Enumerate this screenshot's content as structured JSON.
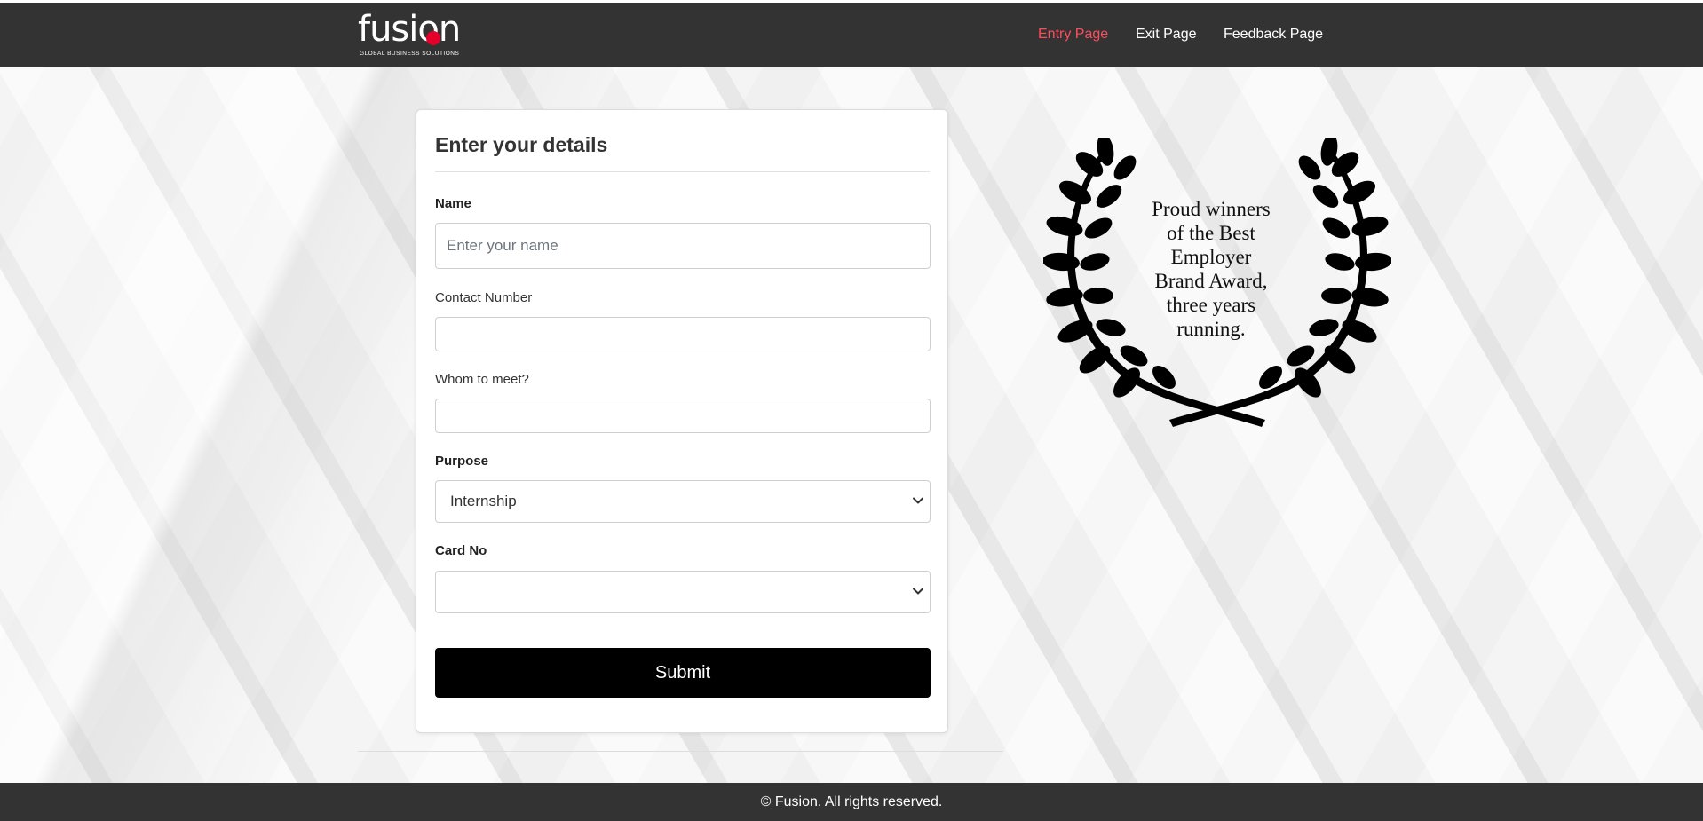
{
  "brand": {
    "name": "fusion",
    "tagline": "GLOBAL BUSINESS SOLUTIONS",
    "accent_color": "#e4002b"
  },
  "nav": {
    "items": [
      {
        "label": "Entry Page",
        "active": true
      },
      {
        "label": "Exit Page",
        "active": false
      },
      {
        "label": "Feedback Page",
        "active": false
      }
    ]
  },
  "form": {
    "title": "Enter your details",
    "name_label": "Name",
    "name_placeholder": "Enter your name",
    "name_value": "",
    "contact_label": "Contact Number",
    "contact_value": "",
    "whom_label": "Whom to meet?",
    "whom_value": "",
    "purpose_label": "Purpose",
    "purpose_selected": "Internship",
    "card_label": "Card No",
    "card_selected": "",
    "submit_label": "Submit"
  },
  "award": {
    "text": "Proud winners of the Best Employer Brand Award, three years running.",
    "lines": [
      "Proud winners",
      "of the Best",
      "Employer",
      "Brand Award,",
      "three years",
      "running."
    ]
  },
  "footer": {
    "text": "© Fusion. All rights reserved."
  }
}
